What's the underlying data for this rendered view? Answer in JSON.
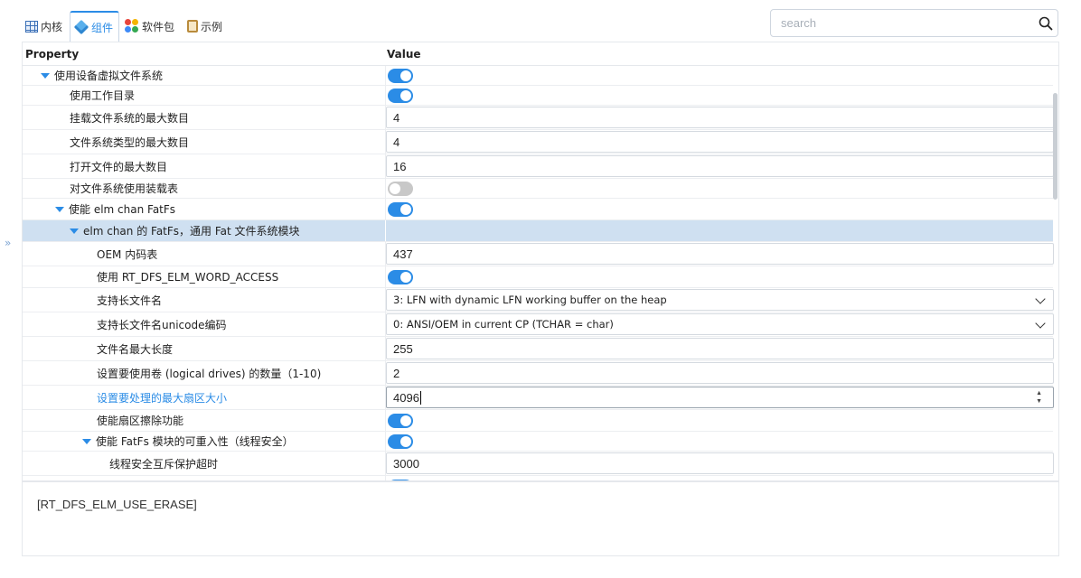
{
  "tabs": [
    {
      "label": "内核",
      "icon": "table-icon"
    },
    {
      "label": "组件",
      "icon": "cube-icon"
    },
    {
      "label": "软件包",
      "icon": "package-dots-icon"
    },
    {
      "label": "示例",
      "icon": "clipboard-icon"
    }
  ],
  "active_tab": "组件",
  "search": {
    "placeholder": "search",
    "value": ""
  },
  "grid": {
    "header_property": "Property",
    "header_value": "Value"
  },
  "rows": [
    {
      "name": "使用设备虚拟文件系统",
      "type": "toggle",
      "on": true,
      "expanded": true
    },
    {
      "name": "使用工作目录",
      "type": "toggle",
      "on": true
    },
    {
      "name": "挂载文件系统的最大数目",
      "type": "text",
      "value": "4"
    },
    {
      "name": "文件系统类型的最大数目",
      "type": "text",
      "value": "4"
    },
    {
      "name": "打开文件的最大数目",
      "type": "text",
      "value": "16"
    },
    {
      "name": "对文件系统使用装载表",
      "type": "toggle",
      "on": false
    },
    {
      "name": "使能 elm chan FatFs",
      "type": "toggle",
      "on": true,
      "expanded": true
    },
    {
      "name": "elm chan 的 FatFs，通用 Fat 文件系统模块",
      "type": "group",
      "expanded": true,
      "selected": true
    },
    {
      "name": "OEM 内码表",
      "type": "text",
      "value": "437"
    },
    {
      "name": "使用 RT_DFS_ELM_WORD_ACCESS",
      "type": "toggle",
      "on": true
    },
    {
      "name": "支持长文件名",
      "type": "select",
      "value": "3: LFN with dynamic LFN working buffer on the heap"
    },
    {
      "name": "支持长文件名unicode编码",
      "type": "select",
      "value": "0: ANSI/OEM in current CP (TCHAR = char)"
    },
    {
      "name": "文件名最大长度",
      "type": "text",
      "value": "255"
    },
    {
      "name": "设置要使用卷 (logical drives) 的数量（1-10)",
      "type": "text",
      "value": "2"
    },
    {
      "name": "设置要处理的最大扇区大小",
      "type": "number",
      "value": "4096",
      "focused": true
    },
    {
      "name": "使能扇区擦除功能",
      "type": "toggle",
      "on": true
    },
    {
      "name": "使能 FatFs 模块的可重入性（线程安全）",
      "type": "toggle",
      "on": true,
      "expanded": true
    },
    {
      "name": "线程安全互斥保护超时",
      "type": "text",
      "value": "3000"
    },
    {
      "name": "",
      "type": "toggle",
      "on": true
    }
  ],
  "description": "[RT_DFS_ELM_USE_ERASE]",
  "colors": {
    "accent": "#2b8ce6",
    "selected_row": "#cfe0f1",
    "toggle_off": "#c8c8c8"
  }
}
